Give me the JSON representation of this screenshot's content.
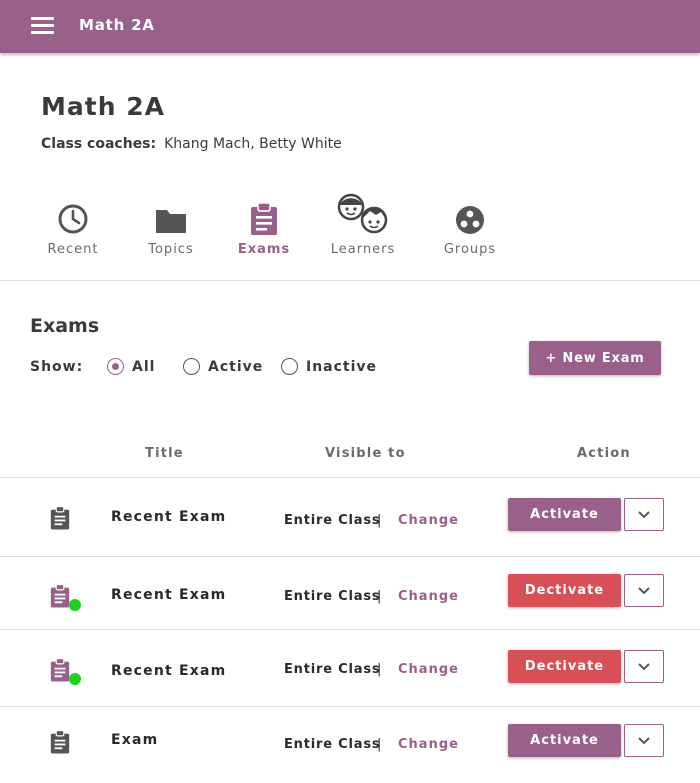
{
  "app_bar": {
    "title": "Math 2A"
  },
  "class": {
    "title": "Math 2A",
    "coaches_label": "Class coaches:",
    "coaches_value": "Khang Mach, Betty White"
  },
  "nav": {
    "tabs": [
      {
        "label": "Recent",
        "icon": "clock-icon"
      },
      {
        "label": "Topics",
        "icon": "folder-icon"
      },
      {
        "label": "Exams",
        "icon": "clipboard-icon",
        "active": true
      },
      {
        "label": "Learners",
        "icon": "people-icon"
      },
      {
        "label": "Groups",
        "icon": "groups-icon"
      }
    ]
  },
  "exams": {
    "section_title": "Exams",
    "show_label": "Show:",
    "filters": [
      {
        "label": "All",
        "checked": true
      },
      {
        "label": "Active",
        "checked": false
      },
      {
        "label": "Inactive",
        "checked": false
      }
    ],
    "new_exam_label": "+ New Exam",
    "columns": {
      "title": "Title",
      "visible_to": "Visible to",
      "action": "Action"
    },
    "rows": [
      {
        "title": "Recent Exam",
        "active": false,
        "visible_to": "Entire Class",
        "separator": "|",
        "change_label": "Change",
        "action_label": "Activate"
      },
      {
        "title": "Recent Exam",
        "active": true,
        "visible_to": "Entire Class",
        "separator": "|",
        "change_label": "Change",
        "action_label": "Dectivate"
      },
      {
        "title": "Recent Exam",
        "active": true,
        "visible_to": "Entire Class",
        "separator": "|",
        "change_label": "Change",
        "action_label": "Dectivate"
      },
      {
        "title": "Exam",
        "active": false,
        "visible_to": "Entire Class",
        "separator": "|",
        "change_label": "Change",
        "action_label": "Activate"
      }
    ]
  },
  "colors": {
    "brand": "#996189",
    "deactivate": "#d75056",
    "active_dot": "#1ed11e",
    "icon_gray": "#555555"
  }
}
